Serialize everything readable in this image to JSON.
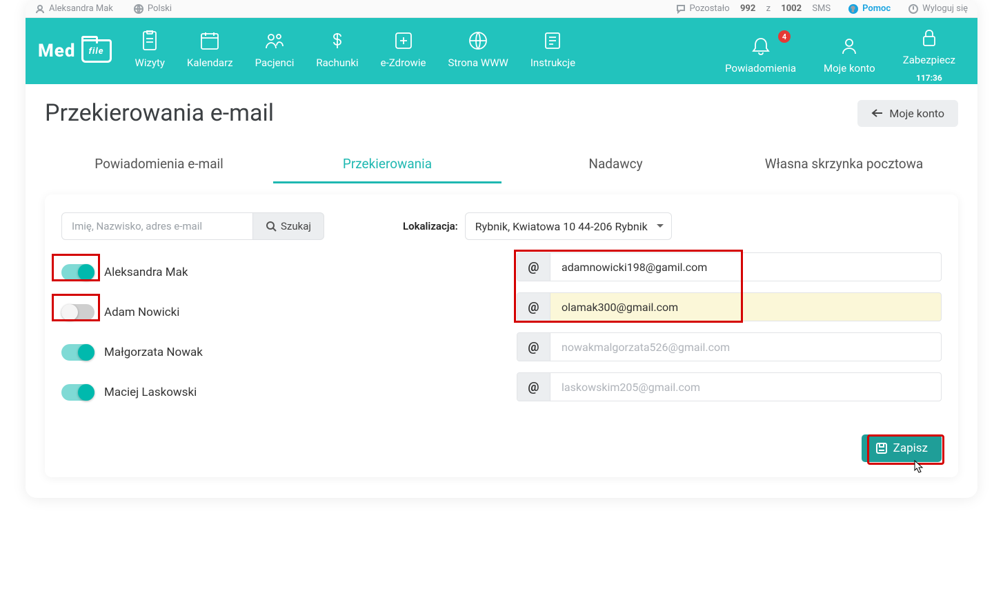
{
  "topbar": {
    "user": "Aleksandra Mak",
    "language": "Polski",
    "sms_prefix": "Pozostało",
    "sms_left": "992",
    "sms_mid": "z",
    "sms_total": "1002",
    "sms_suffix": "SMS",
    "help": "Pomoc",
    "logout": "Wyloguj się"
  },
  "nav": {
    "items": [
      {
        "label": "Wizyty"
      },
      {
        "label": "Kalendarz"
      },
      {
        "label": "Pacjenci"
      },
      {
        "label": "Rachunki"
      },
      {
        "label": "e-Zdrowie"
      },
      {
        "label": "Strona WWW"
      },
      {
        "label": "Instrukcje"
      }
    ],
    "right": [
      {
        "label": "Powiadomienia",
        "badge": "4"
      },
      {
        "label": "Moje konto"
      },
      {
        "label": "Zabezpiecz",
        "timer": "117:36"
      }
    ]
  },
  "page": {
    "title": "Przekierowania e-mail",
    "back": "Moje konto"
  },
  "tabs": [
    {
      "label": "Powiadomienia e-mail",
      "active": false
    },
    {
      "label": "Przekierowania",
      "active": true
    },
    {
      "label": "Nadawcy",
      "active": false
    },
    {
      "label": "Własna skrzynka pocztowa",
      "active": false
    }
  ],
  "search": {
    "placeholder": "Imię, Nazwisko, adres e-mail",
    "button": "Szukaj"
  },
  "location": {
    "label": "Lokalizacja:",
    "value": "Rybnik, Kwiatowa 10 44-206 Rybnik"
  },
  "people": [
    {
      "name": "Aleksandra Mak",
      "on": true,
      "highlight": true
    },
    {
      "name": "Adam Nowicki",
      "on": false,
      "highlight": true
    },
    {
      "name": "Małgorzata Nowak",
      "on": true,
      "highlight": false
    },
    {
      "name": "Maciej Laskowski",
      "on": true,
      "highlight": false
    }
  ],
  "emails": [
    {
      "value": "adamnowicki198@gamil.com",
      "placeholder": false,
      "selected": false,
      "highlight": true
    },
    {
      "value": "olamak300@gmail.com",
      "placeholder": false,
      "selected": true,
      "highlight": true
    },
    {
      "value": "nowakmalgorzata526@gmail.com",
      "placeholder": true,
      "selected": false,
      "highlight": false
    },
    {
      "value": "laskowskim205@gmail.com",
      "placeholder": true,
      "selected": false,
      "highlight": false
    }
  ],
  "save": "Zapisz"
}
